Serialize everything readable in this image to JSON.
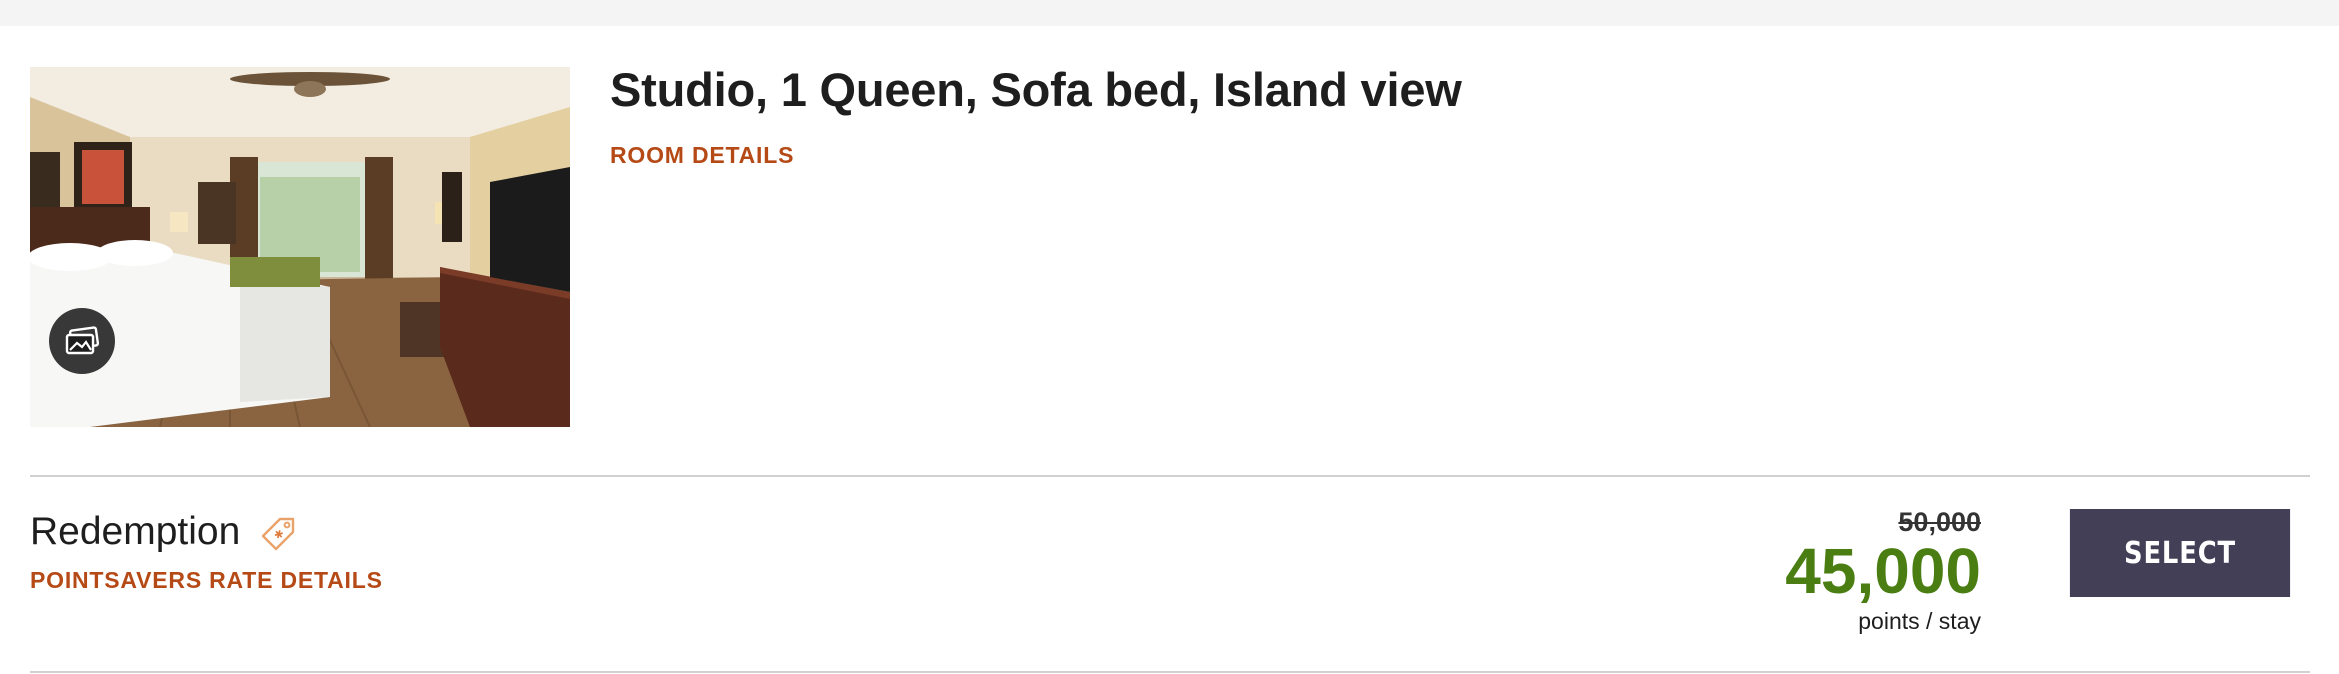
{
  "room": {
    "title": "Studio, 1 Queen, Sofa bed, Island view",
    "details_link": "ROOM DETAILS",
    "photo_icon": "gallery-icon"
  },
  "rate": {
    "name": "Redemption",
    "tag_icon": "price-tag-icon",
    "details_link": "POINTSAVERS RATE DETAILS",
    "original_points": "50,000",
    "points": "45,000",
    "unit": "points / stay",
    "select_label": "SELECT"
  },
  "colors": {
    "accent_link": "#b64a17",
    "points_green": "#4a7e12",
    "button_bg": "#433f57",
    "divider": "#d1d1d1"
  }
}
